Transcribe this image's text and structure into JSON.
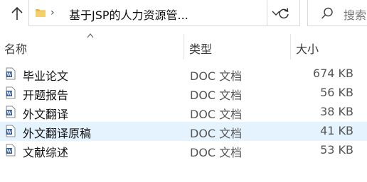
{
  "address_bar": {
    "path": "基于JSP的人力资源管...",
    "search_placeholder": "搜索"
  },
  "columns": {
    "name": "名称",
    "type": "类型",
    "size": "大小"
  },
  "files": [
    {
      "name": "毕业论文",
      "type": "DOC 文档",
      "size": "674 KB"
    },
    {
      "name": "开题报告",
      "type": "DOC 文档",
      "size": "56 KB"
    },
    {
      "name": "外文翻译",
      "type": "DOC 文档",
      "size": "38 KB"
    },
    {
      "name": "外文翻译原稿",
      "type": "DOC 文档",
      "size": "41 KB"
    },
    {
      "name": "文献综述",
      "type": "DOC 文档",
      "size": "53 KB"
    }
  ],
  "selected_row_index": 3,
  "icons": {
    "up": "arrow-up-icon",
    "folder": "folder-icon",
    "dropdown": "chevron-down-icon",
    "refresh": "refresh-icon",
    "search": "search-icon",
    "file": "word-doc-icon"
  },
  "colors": {
    "selected_row": "#e5f3ff",
    "folder": "#e8b84a",
    "doc_icon": "#2b579a"
  }
}
